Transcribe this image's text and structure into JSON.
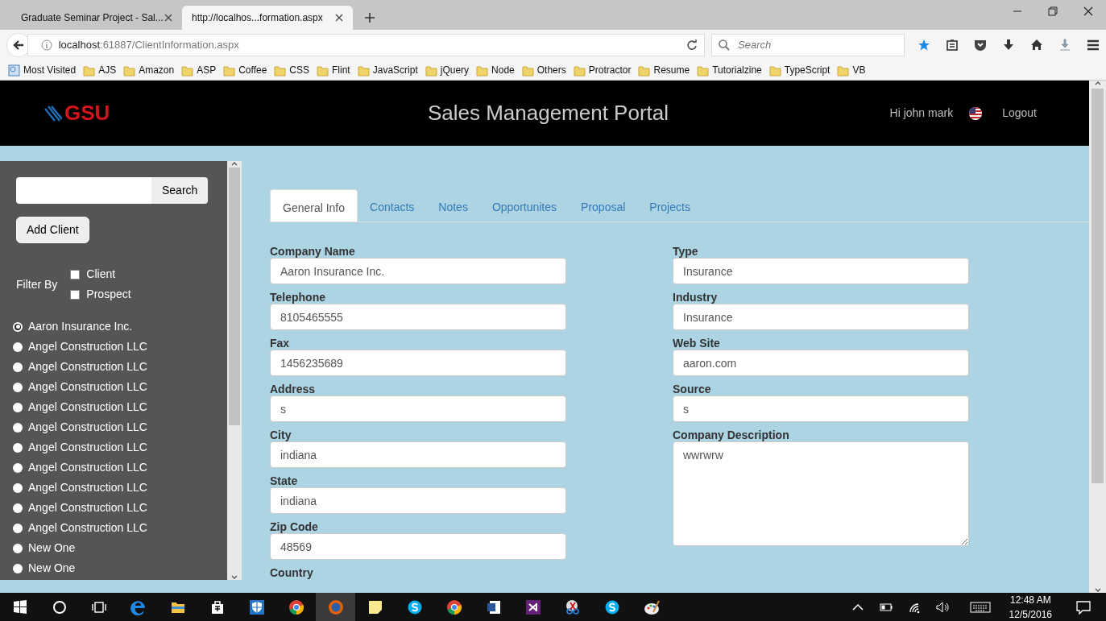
{
  "browser": {
    "tabs": [
      {
        "title": "Graduate Seminar Project - Sal...",
        "selected": false
      },
      {
        "title": "http://localhos...formation.aspx",
        "selected": true
      }
    ],
    "address": {
      "host": "localhost",
      "path": ":61887/ClientInformation.aspx"
    },
    "search": {
      "placeholder": "Search"
    },
    "bookmarks": [
      {
        "label": "Most Visited",
        "kind": "special"
      },
      {
        "label": "AJS",
        "kind": "folder"
      },
      {
        "label": "Amazon",
        "kind": "folder"
      },
      {
        "label": "ASP",
        "kind": "folder"
      },
      {
        "label": "Coffee",
        "kind": "folder"
      },
      {
        "label": "CSS",
        "kind": "folder"
      },
      {
        "label": "Flint",
        "kind": "folder"
      },
      {
        "label": "JavaScript",
        "kind": "folder"
      },
      {
        "label": "jQuery",
        "kind": "folder"
      },
      {
        "label": "Node",
        "kind": "folder"
      },
      {
        "label": "Others",
        "kind": "folder"
      },
      {
        "label": "Protractor",
        "kind": "folder"
      },
      {
        "label": "Resume",
        "kind": "folder"
      },
      {
        "label": "Tutorialzine",
        "kind": "folder"
      },
      {
        "label": "TypeScript",
        "kind": "folder"
      },
      {
        "label": "VB",
        "kind": "folder"
      }
    ]
  },
  "header": {
    "logo": "GSU",
    "title": "Sales Management Portal",
    "greeting": "Hi john mark",
    "logout": "Logout"
  },
  "sidebar": {
    "search_button": "Search",
    "add_button": "Add Client",
    "filter_label": "Filter By",
    "filters": [
      {
        "label": "Client",
        "checked": false
      },
      {
        "label": "Prospect",
        "checked": false
      }
    ],
    "clients": [
      {
        "name": "Aaron Insurance Inc.",
        "selected": true
      },
      {
        "name": "Angel Construction LLC",
        "selected": false
      },
      {
        "name": "Angel Construction LLC",
        "selected": false
      },
      {
        "name": "Angel Construction LLC",
        "selected": false
      },
      {
        "name": "Angel Construction LLC",
        "selected": false
      },
      {
        "name": "Angel Construction LLC",
        "selected": false
      },
      {
        "name": "Angel Construction LLC",
        "selected": false
      },
      {
        "name": "Angel Construction LLC",
        "selected": false
      },
      {
        "name": "Angel Construction LLC",
        "selected": false
      },
      {
        "name": "Angel Construction LLC",
        "selected": false
      },
      {
        "name": "Angel Construction LLC",
        "selected": false
      },
      {
        "name": "New One",
        "selected": false
      },
      {
        "name": "New One",
        "selected": false
      }
    ]
  },
  "tabs": [
    {
      "label": "General Info",
      "selected": true
    },
    {
      "label": "Contacts",
      "selected": false
    },
    {
      "label": "Notes",
      "selected": false
    },
    {
      "label": "Opportunites",
      "selected": false
    },
    {
      "label": "Proposal",
      "selected": false
    },
    {
      "label": "Projects",
      "selected": false
    }
  ],
  "form": {
    "left": [
      {
        "label": "Company Name",
        "value": "Aaron Insurance Inc.",
        "kind": "input"
      },
      {
        "label": "Telephone",
        "value": "8105465555",
        "kind": "input"
      },
      {
        "label": "Fax",
        "value": "1456235689",
        "kind": "input"
      },
      {
        "label": "Address",
        "value": "s",
        "kind": "input"
      },
      {
        "label": "City",
        "value": "indiana",
        "kind": "input"
      },
      {
        "label": "State",
        "value": "indiana",
        "kind": "input"
      },
      {
        "label": "Zip Code",
        "value": "48569",
        "kind": "input"
      },
      {
        "label": "Country",
        "kind": "label"
      }
    ],
    "right": [
      {
        "label": "Type",
        "value": "Insurance",
        "kind": "input"
      },
      {
        "label": "Industry",
        "value": "Insurance",
        "kind": "input"
      },
      {
        "label": "Web Site",
        "value": "aaron.com",
        "kind": "input"
      },
      {
        "label": "Source",
        "value": "s",
        "kind": "input"
      },
      {
        "label": "Company Description",
        "value": "wwrwrw",
        "kind": "textarea"
      }
    ]
  },
  "taskbar": {
    "apps": [
      {
        "kind": "start",
        "active": false
      },
      {
        "kind": "cortana",
        "active": false
      },
      {
        "kind": "taskview",
        "active": false
      },
      {
        "kind": "edge",
        "active": false
      },
      {
        "kind": "explorer",
        "active": false
      },
      {
        "kind": "store",
        "active": false
      },
      {
        "kind": "shield",
        "active": false
      },
      {
        "kind": "chrome",
        "active": false
      },
      {
        "kind": "firefox",
        "active": true
      },
      {
        "kind": "notes",
        "active": false
      },
      {
        "kind": "skype",
        "active": false
      },
      {
        "kind": "chrome",
        "active": false
      },
      {
        "kind": "word",
        "active": false
      },
      {
        "kind": "vs",
        "active": false
      },
      {
        "kind": "snip",
        "active": false
      },
      {
        "kind": "skype",
        "active": false
      },
      {
        "kind": "paint",
        "active": false
      }
    ],
    "time": "12:48 AM",
    "date": "12/5/2016"
  }
}
